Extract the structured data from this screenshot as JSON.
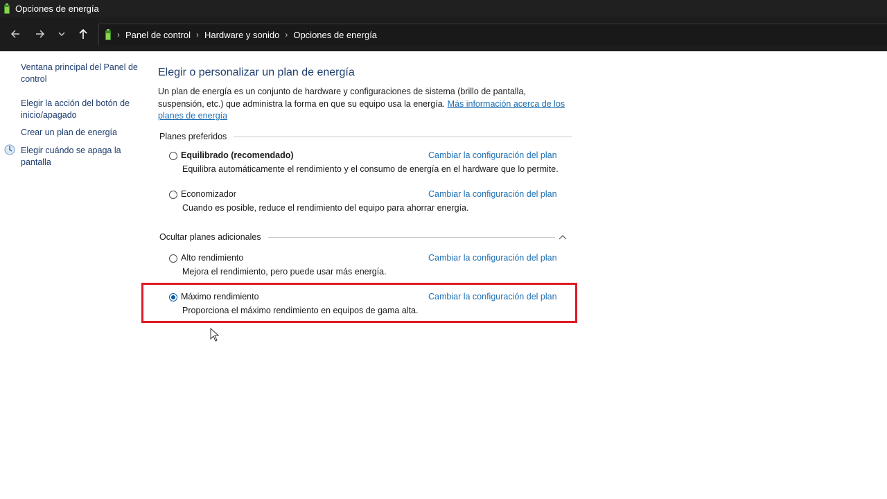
{
  "window": {
    "title": "Opciones de energía"
  },
  "nav": {
    "back_icon": "back-arrow-icon",
    "forward_icon": "forward-arrow-icon",
    "recent_icon": "chevron-down-icon",
    "up_icon": "up-arrow-icon"
  },
  "breadcrumb": [
    "Panel de control",
    "Hardware y sonido",
    "Opciones de energía"
  ],
  "sidebar": {
    "links": [
      "Ventana principal del Panel de control",
      "Elegir la acción del botón de inicio/apagado",
      "Crear un plan de energía",
      "Elegir cuándo se apaga la pantalla"
    ]
  },
  "main": {
    "title": "Elegir o personalizar un plan de energía",
    "description": "Un plan de energía es un conjunto de hardware y configuraciones de sistema (brillo de pantalla, suspensión, etc.) que administra la forma en que su equipo usa la energía.",
    "more_info_link": "Más información acerca de los planes de energía",
    "preferred_group": "Planes preferidos",
    "additional_group": "Ocultar planes adicionales",
    "change_link": "Cambiar la configuración del plan",
    "plans": [
      {
        "name": "Equilibrado (recomendado)",
        "description": "Equilibra automáticamente el rendimiento y el consumo de energía en el hardware que lo permite.",
        "selected": false
      },
      {
        "name": "Economizador",
        "description": "Cuando es posible, reduce el rendimiento del equipo para ahorrar energía.",
        "selected": false
      },
      {
        "name": "Alto rendimiento",
        "description": "Mejora el rendimiento, pero puede usar más energía.",
        "selected": false
      },
      {
        "name": "Máximo rendimiento",
        "description": "Proporciona el máximo rendimiento en equipos de gama alta.",
        "selected": true
      }
    ]
  },
  "colors": {
    "accent": "#1e6fb3",
    "title": "#1e3d6e",
    "highlight": "#e01b24"
  }
}
